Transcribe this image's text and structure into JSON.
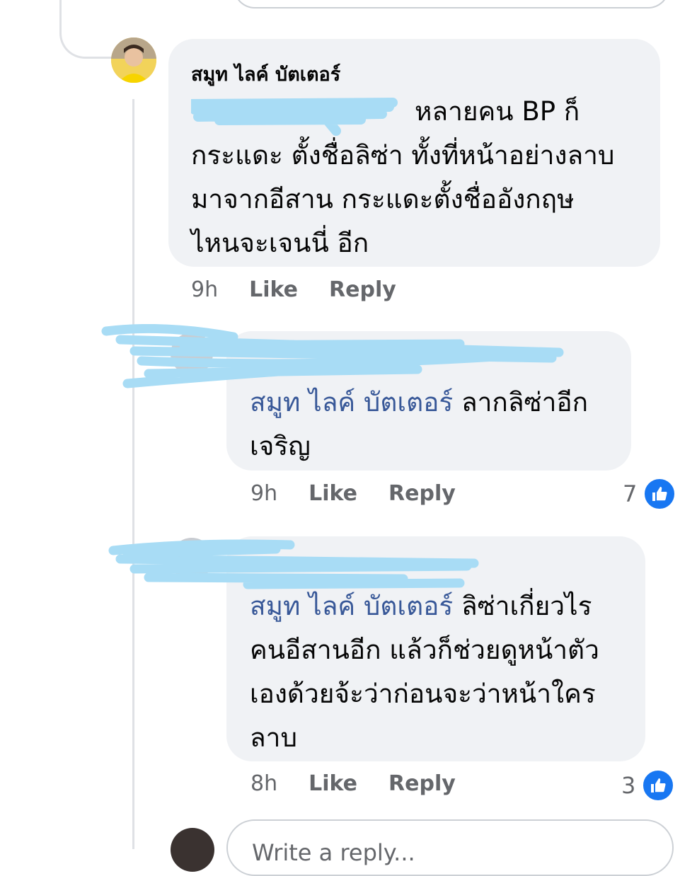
{
  "main_comment": {
    "author": "สมูท ไลค์ บัตเตอร์",
    "text_lines": [
      "หลายคน BP ก็",
      "กระแดะ ตั้งชื่อลิซ่า ทั้งที่หน้าอย่างลาบ",
      "มาจากอีสาน กระแดะตั้งชื่ออังกฤษ",
      "ไหนจะเจนนี่ อีก"
    ],
    "time": "9h",
    "like_label": "Like",
    "reply_label": "Reply"
  },
  "reply1": {
    "mention": "สมูท ไลค์ บัตเตอร์",
    "text_after_mention": " ลากลิซ่าอีก",
    "text_line2": "เจริญ",
    "time": "9h",
    "like_label": "Like",
    "reply_label": "Reply",
    "reaction_count": "7"
  },
  "reply2": {
    "mention": "สมูท ไลค์ บัตเตอร์",
    "text_after_mention": " ลิซ่าเกี่ยวไร",
    "text_lines": [
      "คนอีสานอีก แล้วก็ช่วยดูหน้าตัว",
      "เองด้วยจ้ะว่าก่อนจะว่าหน้าใคร",
      "ลาบ"
    ],
    "time": "8h",
    "like_label": "Like",
    "reply_label": "Reply",
    "reaction_count": "3"
  },
  "reply_input": {
    "placeholder": "Write a reply..."
  },
  "colors": {
    "bubble": "#f0f2f5",
    "mention": "#385898",
    "like_blue": "#1877f2",
    "scribble": "#a8dcf5"
  },
  "icons": [
    "like-icon"
  ]
}
